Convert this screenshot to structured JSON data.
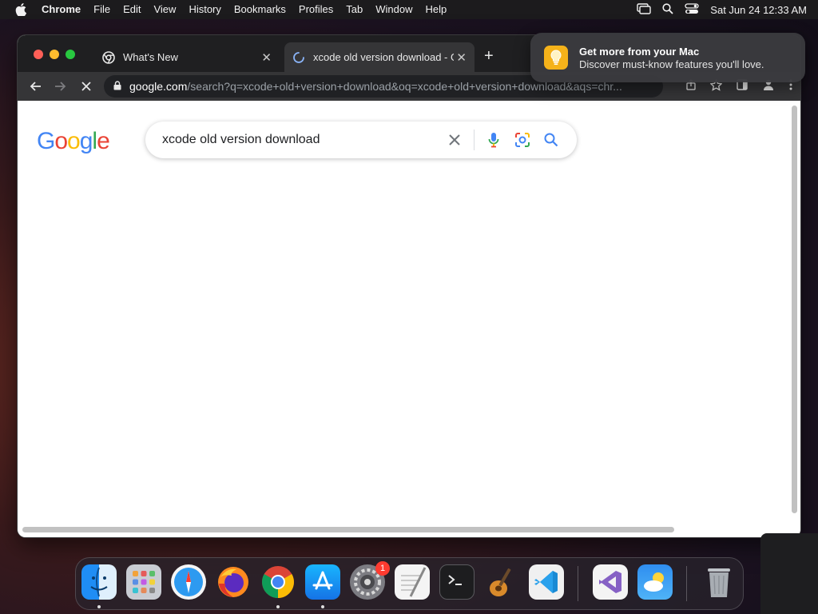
{
  "menubar": {
    "app_name": "Chrome",
    "menus": [
      "File",
      "Edit",
      "View",
      "History",
      "Bookmarks",
      "Profiles",
      "Tab",
      "Window",
      "Help"
    ],
    "clock": "Sat Jun 24  12:33 AM"
  },
  "browser": {
    "tabs": [
      {
        "title": "What's New",
        "active": false
      },
      {
        "title": "xcode old version download - G",
        "active": true,
        "loading": true
      }
    ],
    "omnibox": {
      "host": "google.com",
      "path": "/search?q=xcode+old+version+download&oq=xcode+old+version+download&aqs=chr..."
    }
  },
  "page": {
    "logo_text": "Google",
    "search_query": "xcode old version download"
  },
  "notification": {
    "title": "Get more from your Mac",
    "body": "Discover must-know features you'll love."
  },
  "dock": {
    "apps": [
      "Finder",
      "Launchpad",
      "Safari",
      "Firefox",
      "Google Chrome",
      "App Store",
      "System Settings",
      "TextEdit",
      "Terminal",
      "GarageBand",
      "Visual Studio Code",
      "Visual Studio",
      "Weather",
      "Trash"
    ],
    "system_settings_badge": "1"
  },
  "colors": {
    "accent_blue": "#4285f4",
    "google_red": "#ea4335",
    "google_yellow": "#fbbc05",
    "google_green": "#34a853"
  }
}
